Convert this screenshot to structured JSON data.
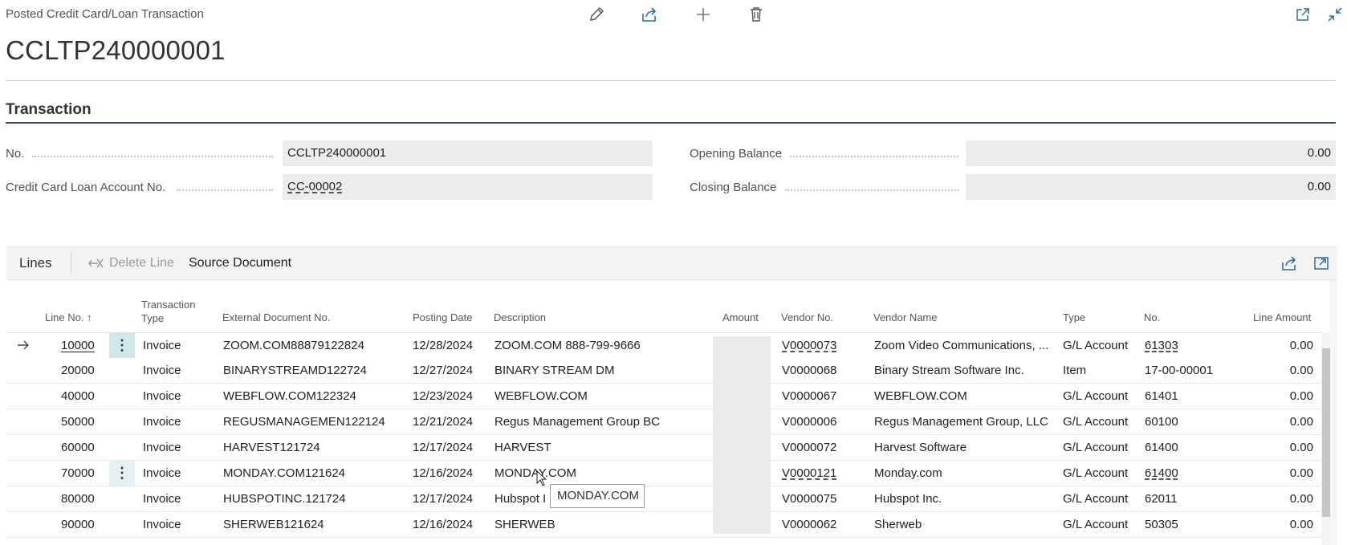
{
  "breadcrumb": "Posted Credit Card/Loan Transaction",
  "page_title": "CCLTP240000001",
  "section_title": "Transaction",
  "fields": {
    "no_label": "No.",
    "no_value": "CCLTP240000001",
    "account_label": "Credit Card Loan Account No.",
    "account_value": "CC-00002",
    "opening_label": "Opening Balance",
    "opening_value": "0.00",
    "closing_label": "Closing Balance",
    "closing_value": "0.00"
  },
  "lines": {
    "title": "Lines",
    "delete_label": "Delete Line",
    "source_label": "Source Document",
    "headers": {
      "line_no": "Line No. ↑",
      "transaction_type_1": "Transaction",
      "transaction_type_2": "Type",
      "ext_doc": "External Document No.",
      "posting_date": "Posting Date",
      "description": "Description",
      "amount": "Amount",
      "vendor_no": "Vendor No.",
      "vendor_name": "Vendor Name",
      "type": "Type",
      "no": "No.",
      "line_amount": "Line Amount"
    },
    "rows": [
      {
        "line_no": "10000",
        "ttype": "Invoice",
        "ext": "ZOOM.COM88879122824",
        "date": "12/28/2024",
        "desc": "ZOOM.COM 888-799-9666",
        "vendor_no": "V0000073",
        "vendor_name": "Zoom Video Communications, ...",
        "type": "G/L Account",
        "no": "61303",
        "line_amount": "0.00"
      },
      {
        "line_no": "20000",
        "ttype": "Invoice",
        "ext": "BINARYSTREAMD122724",
        "date": "12/27/2024",
        "desc": "BINARY STREAM DM",
        "vendor_no": "V0000068",
        "vendor_name": "Binary Stream Software Inc.",
        "type": "Item",
        "no": "17-00-00001",
        "line_amount": "0.00"
      },
      {
        "line_no": "40000",
        "ttype": "Invoice",
        "ext": "WEBFLOW.COM122324",
        "date": "12/23/2024",
        "desc": "WEBFLOW.COM",
        "vendor_no": "V0000067",
        "vendor_name": "WEBFLOW.COM",
        "type": "G/L Account",
        "no": "61401",
        "line_amount": "0.00"
      },
      {
        "line_no": "50000",
        "ttype": "Invoice",
        "ext": "REGUSMANAGEMEN122124",
        "date": "12/21/2024",
        "desc": "Regus Management Group BC",
        "vendor_no": "V0000006",
        "vendor_name": "Regus Management Group, LLC",
        "type": "G/L Account",
        "no": "60100",
        "line_amount": "0.00"
      },
      {
        "line_no": "60000",
        "ttype": "Invoice",
        "ext": "HARVEST121724",
        "date": "12/17/2024",
        "desc": "HARVEST",
        "vendor_no": "V0000072",
        "vendor_name": "Harvest Software",
        "type": "G/L Account",
        "no": "61400",
        "line_amount": "0.00"
      },
      {
        "line_no": "70000",
        "ttype": "Invoice",
        "ext": "MONDAY.COM121624",
        "date": "12/16/2024",
        "desc": "MONDAY.COM",
        "vendor_no": "V0000121",
        "vendor_name": "Monday.com",
        "type": "G/L Account",
        "no": "61400",
        "line_amount": "0.00"
      },
      {
        "line_no": "80000",
        "ttype": "Invoice",
        "ext": "HUBSPOTINC.121724",
        "date": "12/17/2024",
        "desc": "Hubspot I",
        "vendor_no": "V0000075",
        "vendor_name": "Hubspot Inc.",
        "type": "G/L Account",
        "no": "62011",
        "line_amount": "0.00"
      },
      {
        "line_no": "90000",
        "ttype": "Invoice",
        "ext": "SHERWEB121624",
        "date": "12/16/2024",
        "desc": "SHERWEB",
        "vendor_no": "V0000062",
        "vendor_name": "Sherweb",
        "type": "G/L Account",
        "no": "50305",
        "line_amount": "0.00"
      }
    ],
    "tooltip": "MONDAY.COM"
  },
  "icons": [
    "edit-icon",
    "share-icon",
    "add-icon",
    "delete-icon",
    "open-new-window-icon",
    "collapse-icon",
    "row-arrow-icon",
    "delete-line-icon",
    "kebab-icon",
    "share-lines-icon",
    "expand-lines-icon"
  ]
}
